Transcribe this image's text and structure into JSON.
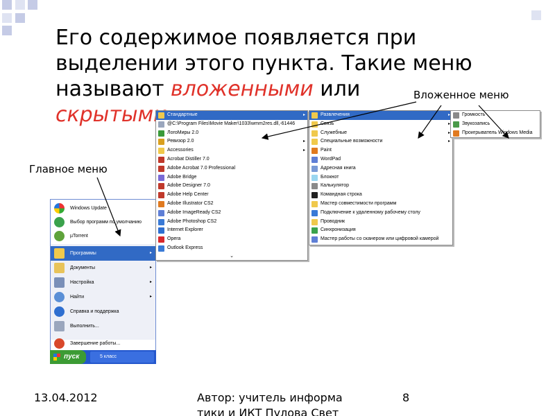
{
  "title": {
    "line1": "Его содержимое появляется при",
    "line2": "выделении этого пункта. Такие меню",
    "line3_prefix": "называют ",
    "line3_em": "вложенными",
    "line3_suffix": " или",
    "line4_em": "скрытыми"
  },
  "callouts": {
    "nested": "Вложенное меню",
    "main": "Главное меню"
  },
  "start_menu": {
    "pinned": [
      "Windows Update",
      "Выбор программ по умолчанию",
      "µTorrent"
    ],
    "items": [
      {
        "label": "Программы",
        "arrow": "▸"
      },
      {
        "label": "Документы",
        "arrow": "▸"
      },
      {
        "label": "Настройка",
        "arrow": "▸"
      },
      {
        "label": "Найти",
        "arrow": "▸"
      },
      {
        "label": "Справка и поддержка",
        "arrow": ""
      },
      {
        "label": "Выполнить...",
        "arrow": ""
      },
      {
        "label": "Завершение работы...",
        "arrow": ""
      }
    ],
    "start_button": "пуск",
    "task_item": "5 класс"
  },
  "programs_menu": {
    "items": [
      "Стандартные",
      "@C:\\Program Files\\Movie Maker\\1033\\wmm2res.dll,-61446",
      "ЛогоМиры 2.0",
      "Ревизор 2.0",
      "Accessories",
      "Acrobat Distiller 7.0",
      "Adobe Acrobat 7.0 Professional",
      "Adobe Bridge",
      "Adobe Designer 7.0",
      "Adobe Help Center",
      "Adobe Illustrator CS2",
      "Adobe ImageReady CS2",
      "Adobe Photoshop CS2",
      "Internet Explorer",
      "Opera",
      "Outlook Express"
    ],
    "chevron": "⌄"
  },
  "accessories_menu": {
    "items": [
      "Развлечения",
      "Связь",
      "Служебные",
      "Специальные возможности",
      "Paint",
      "WordPad",
      "Адресная книга",
      "Блокнот",
      "Калькулятор",
      "Командная строка",
      "Мастер совместимости программ",
      "Подключение к удаленному рабочему столу",
      "Проводник",
      "Синхронизация",
      "Мастер работы со сканером или цифровой камерой"
    ]
  },
  "entertainment_menu": {
    "items": [
      "Громкость",
      "Звукозапись",
      "Проигрыватель Windows Media"
    ]
  },
  "footer": {
    "date": "13.04.2012",
    "author_line1": "Автор: учитель информа",
    "author_line2": "тики и ИКТ Пулова Свет",
    "page": "8"
  },
  "colors": {
    "accent": "#e0322a",
    "highlight": "#316ac5",
    "taskbar": "#2457cc",
    "start_button": "#3c9b34"
  }
}
